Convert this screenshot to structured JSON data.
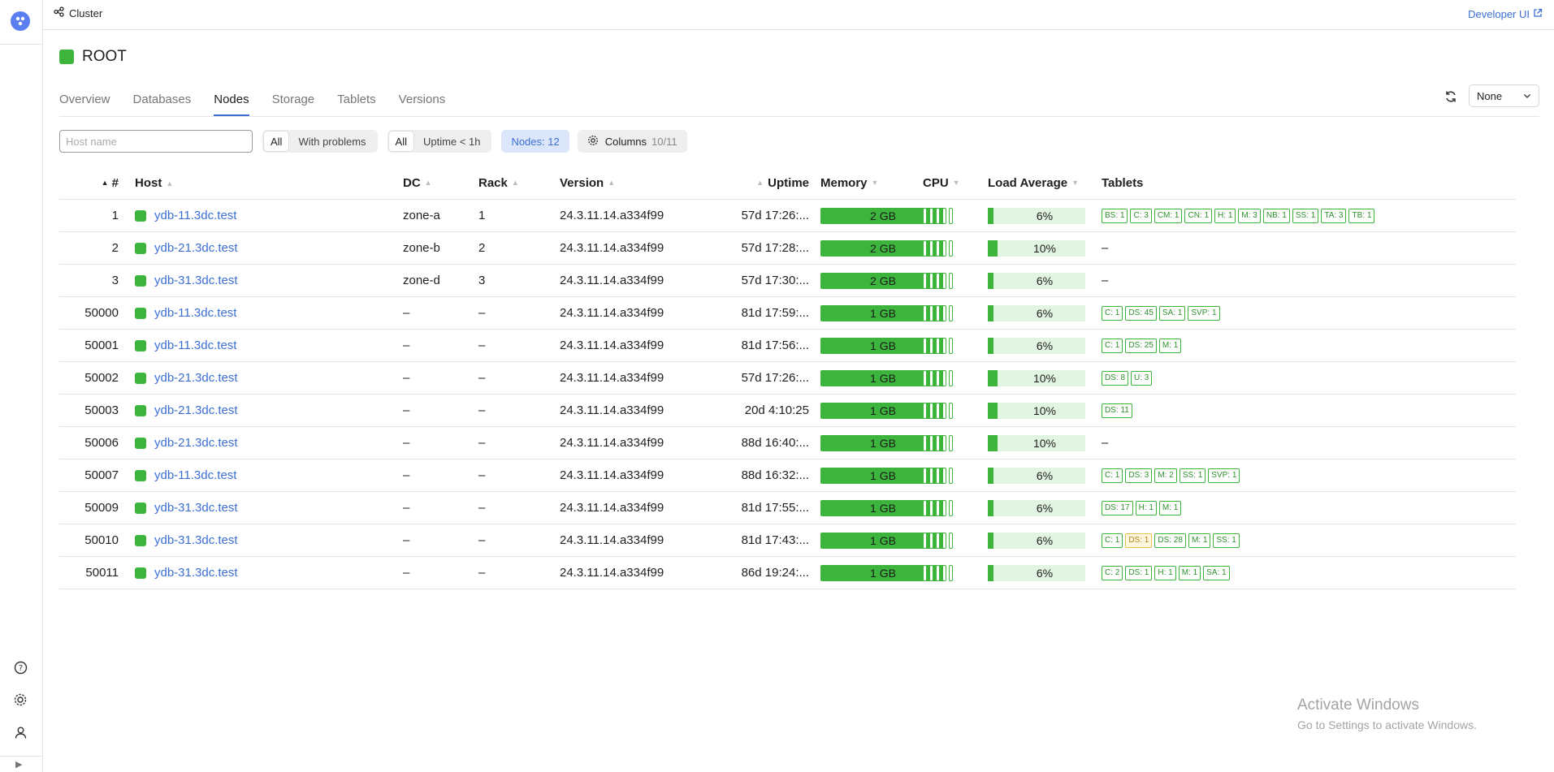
{
  "breadcrumb": {
    "label": "Cluster"
  },
  "header": {
    "developer_link": "Developer UI"
  },
  "title": "ROOT",
  "tabs": [
    {
      "label": "Overview"
    },
    {
      "label": "Databases"
    },
    {
      "label": "Nodes",
      "active": true
    },
    {
      "label": "Storage"
    },
    {
      "label": "Tablets"
    },
    {
      "label": "Versions"
    }
  ],
  "refresh_select": {
    "value": "None"
  },
  "filters": {
    "search_placeholder": "Host name",
    "problem_filter": {
      "all": "All",
      "problems": "With problems",
      "selected": "All"
    },
    "uptime_filter": {
      "all": "All",
      "short": "Uptime < 1h",
      "selected": "All"
    },
    "nodes_count": "Nodes: 12",
    "columns_button": "Columns",
    "columns_count": "10/11"
  },
  "table": {
    "columns": {
      "num": "#",
      "host": "Host",
      "dc": "DC",
      "rack": "Rack",
      "version": "Version",
      "uptime": "Uptime",
      "memory": "Memory",
      "cpu": "CPU",
      "load": "Load Average",
      "tablets": "Tablets"
    },
    "rows": [
      {
        "num": "1",
        "host": "ydb-11.3dc.test",
        "dc": "zone-a",
        "rack": "1",
        "version": "24.3.11.14.a334f99",
        "uptime": "57d 17:26:...",
        "memory": "2 GB",
        "load": "6%",
        "load_pct": 6,
        "tablets": [
          {
            "t": "BS: 1"
          },
          {
            "t": "C: 3"
          },
          {
            "t": "CM: 1"
          },
          {
            "t": "CN: 1"
          },
          {
            "t": "H: 1"
          },
          {
            "t": "M: 3"
          },
          {
            "t": "NB: 1"
          },
          {
            "t": "SS: 1"
          },
          {
            "t": "TA: 3"
          },
          {
            "t": "TB: 1"
          }
        ]
      },
      {
        "num": "2",
        "host": "ydb-21.3dc.test",
        "dc": "zone-b",
        "rack": "2",
        "version": "24.3.11.14.a334f99",
        "uptime": "57d 17:28:...",
        "memory": "2 GB",
        "load": "10%",
        "load_pct": 10,
        "tablets_empty": "–",
        "tablets": []
      },
      {
        "num": "3",
        "host": "ydb-31.3dc.test",
        "dc": "zone-d",
        "rack": "3",
        "version": "24.3.11.14.a334f99",
        "uptime": "57d 17:30:...",
        "memory": "2 GB",
        "load": "6%",
        "load_pct": 6,
        "tablets_empty": "–",
        "tablets": []
      },
      {
        "num": "50000",
        "host": "ydb-11.3dc.test",
        "dc": "–",
        "rack": "–",
        "version": "24.3.11.14.a334f99",
        "uptime": "81d 17:59:...",
        "memory": "1 GB",
        "load": "6%",
        "load_pct": 6,
        "tablets": [
          {
            "t": "C: 1"
          },
          {
            "t": "DS: 45"
          },
          {
            "t": "SA: 1"
          },
          {
            "t": "SVP: 1"
          }
        ]
      },
      {
        "num": "50001",
        "host": "ydb-11.3dc.test",
        "dc": "–",
        "rack": "–",
        "version": "24.3.11.14.a334f99",
        "uptime": "81d 17:56:...",
        "memory": "1 GB",
        "load": "6%",
        "load_pct": 6,
        "tablets": [
          {
            "t": "C: 1"
          },
          {
            "t": "DS: 25"
          },
          {
            "t": "M: 1"
          }
        ]
      },
      {
        "num": "50002",
        "host": "ydb-21.3dc.test",
        "dc": "–",
        "rack": "–",
        "version": "24.3.11.14.a334f99",
        "uptime": "57d 17:26:...",
        "memory": "1 GB",
        "load": "10%",
        "load_pct": 10,
        "tablets": [
          {
            "t": "DS: 8"
          },
          {
            "t": "U: 3"
          }
        ]
      },
      {
        "num": "50003",
        "host": "ydb-21.3dc.test",
        "dc": "–",
        "rack": "–",
        "version": "24.3.11.14.a334f99",
        "uptime": "20d 4:10:25",
        "memory": "1 GB",
        "load": "10%",
        "load_pct": 10,
        "tablets": [
          {
            "t": "DS: 11"
          }
        ]
      },
      {
        "num": "50006",
        "host": "ydb-21.3dc.test",
        "dc": "–",
        "rack": "–",
        "version": "24.3.11.14.a334f99",
        "uptime": "88d 16:40:...",
        "memory": "1 GB",
        "load": "10%",
        "load_pct": 10,
        "tablets_empty": "–",
        "tablets": []
      },
      {
        "num": "50007",
        "host": "ydb-11.3dc.test",
        "dc": "–",
        "rack": "–",
        "version": "24.3.11.14.a334f99",
        "uptime": "88d 16:32:...",
        "memory": "1 GB",
        "load": "6%",
        "load_pct": 6,
        "tablets": [
          {
            "t": "C: 1"
          },
          {
            "t": "DS: 3"
          },
          {
            "t": "M: 2"
          },
          {
            "t": "SS: 1"
          },
          {
            "t": "SVP: 1"
          }
        ]
      },
      {
        "num": "50009",
        "host": "ydb-31.3dc.test",
        "dc": "–",
        "rack": "–",
        "version": "24.3.11.14.a334f99",
        "uptime": "81d 17:55:...",
        "memory": "1 GB",
        "load": "6%",
        "load_pct": 6,
        "tablets": [
          {
            "t": "DS: 17"
          },
          {
            "t": "H: 1"
          },
          {
            "t": "M: 1"
          }
        ]
      },
      {
        "num": "50010",
        "host": "ydb-31.3dc.test",
        "dc": "–",
        "rack": "–",
        "version": "24.3.11.14.a334f99",
        "uptime": "81d 17:43:...",
        "memory": "1 GB",
        "load": "6%",
        "load_pct": 6,
        "tablets": [
          {
            "t": "C: 1"
          },
          {
            "t": "DS: 1",
            "warn": true
          },
          {
            "t": "DS: 28"
          },
          {
            "t": "M: 1"
          },
          {
            "t": "SS: 1"
          }
        ]
      },
      {
        "num": "50011",
        "host": "ydb-31.3dc.test",
        "dc": "–",
        "rack": "–",
        "version": "24.3.11.14.a334f99",
        "uptime": "86d 19:24:...",
        "memory": "1 GB",
        "load": "6%",
        "load_pct": 6,
        "tablets": [
          {
            "t": "C: 2"
          },
          {
            "t": "DS: 1"
          },
          {
            "t": "H: 1"
          },
          {
            "t": "M: 1"
          },
          {
            "t": "SA: 1"
          }
        ]
      }
    ]
  },
  "watermark": {
    "line1": "Activate Windows",
    "line2": "Go to Settings to activate Windows."
  },
  "colors": {
    "accent": "#3b6fd4",
    "ok": "#3db53d",
    "warn": "#e8c24c"
  },
  "icons": [
    "cluster-icon",
    "external-link-icon",
    "refresh-icon",
    "chevron-down-icon",
    "gear-icon",
    "help-icon",
    "settings-icon",
    "user-icon",
    "expand-icon"
  ]
}
